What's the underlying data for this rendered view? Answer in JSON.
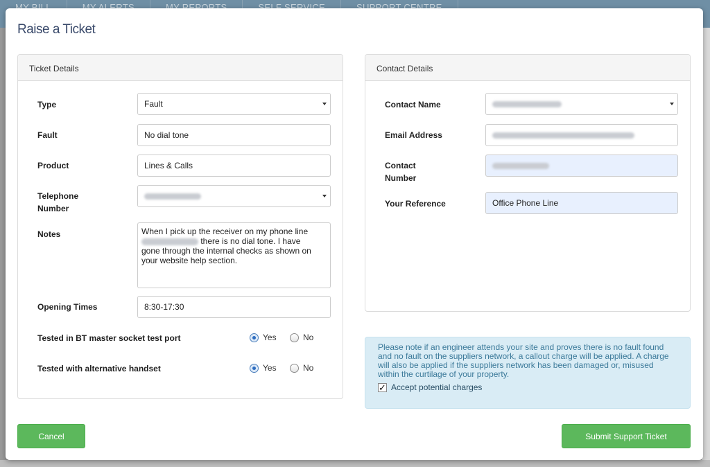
{
  "background_nav": [
    "MY BILL",
    "MY ALERTS",
    "MY REPORTS",
    "SELF SERVICE",
    "SUPPORT CENTRE"
  ],
  "modal": {
    "title": "Raise a Ticket"
  },
  "ticket": {
    "heading": "Ticket Details",
    "type_label": "Type",
    "type_value": "Fault",
    "fault_label": "Fault",
    "fault_value": "No dial tone",
    "product_label": "Product",
    "product_value": "Lines & Calls",
    "telephone_label_1": "Telephone",
    "telephone_label_2": "Number",
    "notes_label": "Notes",
    "notes_line1": "When I pick up the receiver on my phone line",
    "notes_line2_rest": "there is no dial tone. I have",
    "notes_line3": "gone through the internal checks as shown on",
    "notes_line4": "your website help section.",
    "opening_label": "Opening Times",
    "opening_value": "8:30-17:30",
    "bt_test_label": "Tested in BT master socket test port",
    "alt_handset_label": "Tested with alternative handset",
    "yes": "Yes",
    "no": "No",
    "bt_test_selected": "Yes",
    "alt_handset_selected": "Yes"
  },
  "contact": {
    "heading": "Contact Details",
    "name_label": "Contact Name",
    "email_label": "Email Address",
    "number_label_1": "Contact",
    "number_label_2": "Number",
    "reference_label": "Your Reference",
    "reference_value": "Office Phone Line"
  },
  "notice": {
    "text": "Please note if an engineer attends your site and proves there is no fault found and no fault on the suppliers network, a callout charge will be applied. A charge will also be applied if the suppliers network has been damaged or, misused within the curtilage of your property.",
    "accept_label": "Accept potential charges",
    "accept_checked": true
  },
  "buttons": {
    "cancel": "Cancel",
    "submit": "Submit Support Ticket"
  },
  "colors": {
    "accent_green": "#5cb85c",
    "title_blue": "#3a4a6b",
    "notice_bg": "#d9ecf5"
  }
}
